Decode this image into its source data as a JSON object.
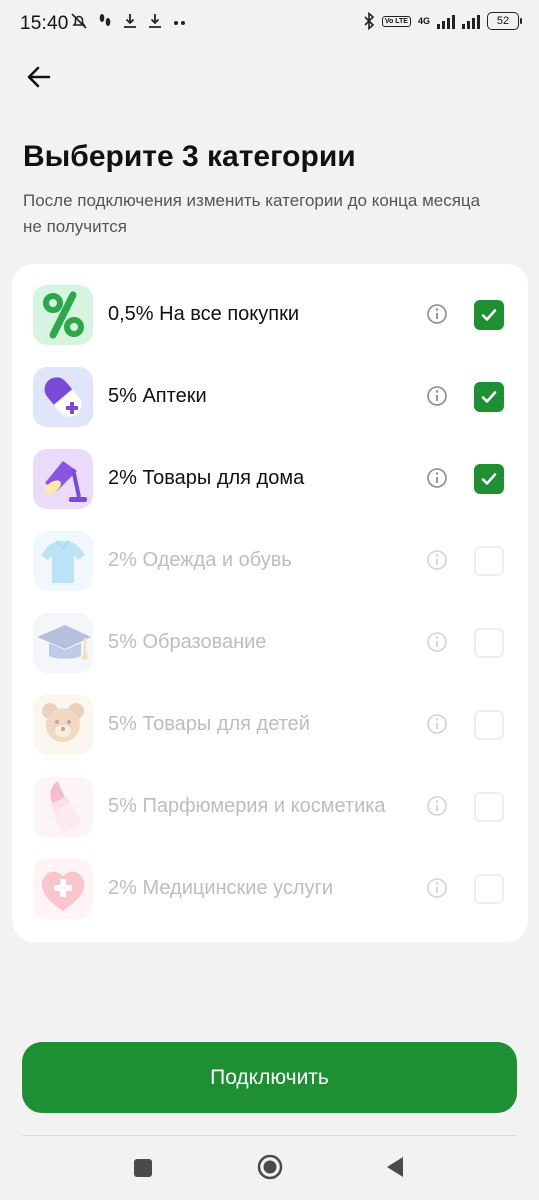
{
  "status_bar": {
    "time": "15:40",
    "network": "4G",
    "volte": "Vo LTE",
    "battery": "52"
  },
  "header": {
    "title": "Выберите 3 категории",
    "subtitle": "После подключения изменить категории до конца месяца не получится"
  },
  "categories": [
    {
      "label": "0,5% На все покупки",
      "icon": "percent-icon",
      "checked": true,
      "enabled": true
    },
    {
      "label": "5% Аптеки",
      "icon": "pill-icon",
      "checked": true,
      "enabled": true
    },
    {
      "label": "2% Товары для дома",
      "icon": "lamp-icon",
      "checked": true,
      "enabled": true
    },
    {
      "label": "2% Одежда и обувь",
      "icon": "shirt-icon",
      "checked": false,
      "enabled": false
    },
    {
      "label": "5% Образование",
      "icon": "graduation-cap-icon",
      "checked": false,
      "enabled": false
    },
    {
      "label": "5% Товары для детей",
      "icon": "teddy-bear-icon",
      "checked": false,
      "enabled": false
    },
    {
      "label": "5% Парфюмерия и косметика",
      "icon": "lipstick-icon",
      "checked": false,
      "enabled": false
    },
    {
      "label": "2% Медицинские услуги",
      "icon": "medical-heart-icon",
      "checked": false,
      "enabled": false
    }
  ],
  "actions": {
    "connect_label": "Подключить"
  },
  "colors": {
    "accent": "#1e8f32",
    "background": "#f2f2f2",
    "card": "#ffffff",
    "disabled_text": "#bdbdbd"
  }
}
